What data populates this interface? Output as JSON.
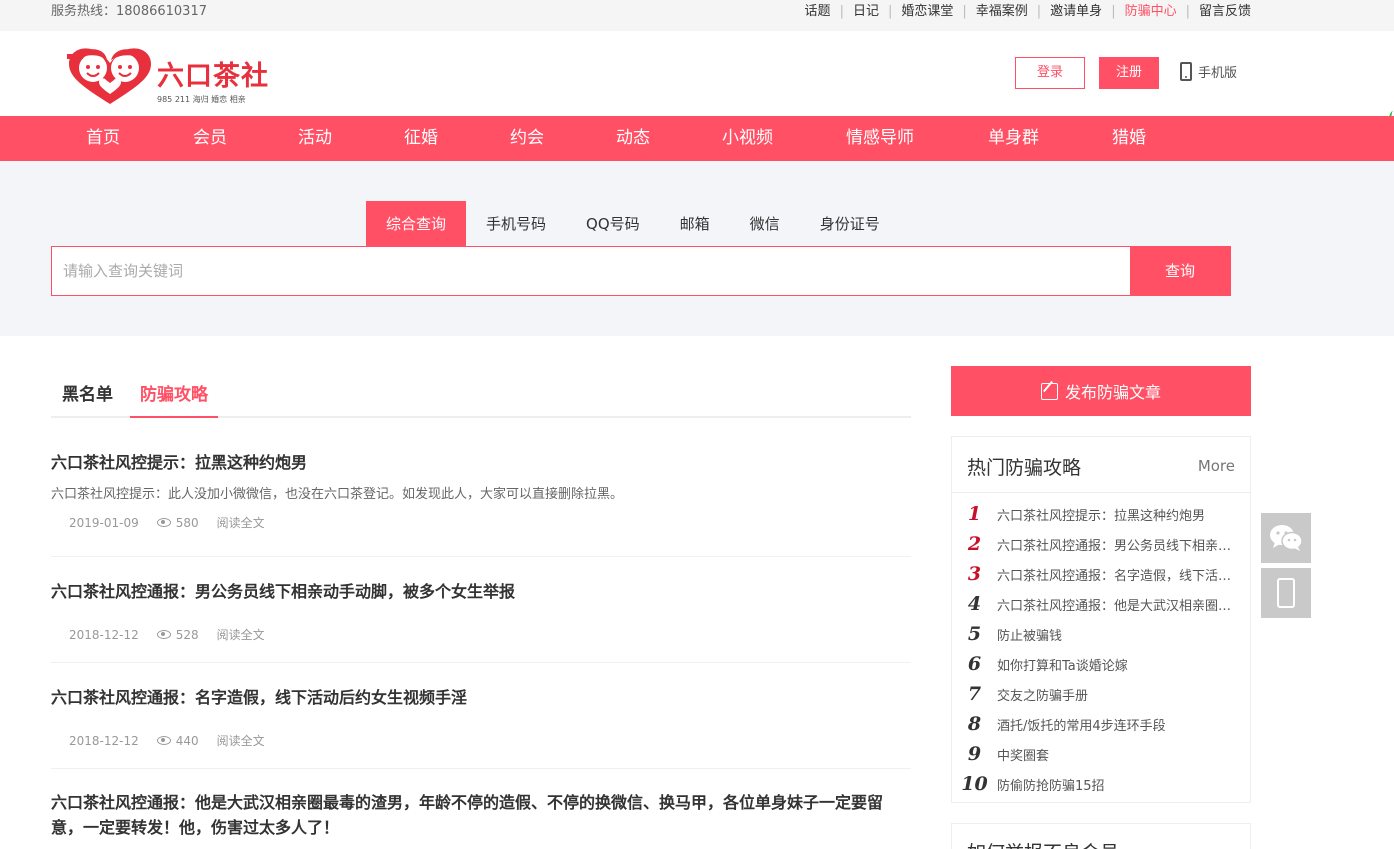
{
  "topbar": {
    "hotline": "服务热线：18086610317",
    "links": [
      "话题",
      "日记",
      "婚恋课堂",
      "幸福案例",
      "邀请单身",
      "防骗中心",
      "留言反馈"
    ],
    "active_link": "防骗中心"
  },
  "header": {
    "logo_name": "六口茶社",
    "logo_slogan": "985 211 海归 婚恋 相亲",
    "login_label": "登录",
    "register_label": "注册",
    "mobile_label": "手机版"
  },
  "nav": {
    "items": [
      "首页",
      "会员",
      "活动",
      "征婚",
      "约会",
      "动态",
      "小视频",
      "情感导师",
      "单身群",
      "猎婚"
    ]
  },
  "search": {
    "tabs": [
      "综合查询",
      "手机号码",
      "QQ号码",
      "邮箱",
      "微信",
      "身份证号"
    ],
    "active_tab": "综合查询",
    "placeholder": "请输入查询关键词",
    "button_label": "查询"
  },
  "main": {
    "tabs": [
      "黑名单",
      "防骗攻略"
    ],
    "active_tab": "防骗攻略",
    "articles": [
      {
        "title": "六口茶社风控提示：拉黑这种约炮男",
        "desc": "六口茶社风控提示：此人没加小微微信，也没在六口茶登记。如发现此人，大家可以直接删除拉黑。",
        "date": "2019-01-09",
        "views": "580",
        "read": "阅读全文"
      },
      {
        "title": "六口茶社风控通报：男公务员线下相亲动手动脚，被多个女生举报",
        "desc": "",
        "date": "2018-12-12",
        "views": "528",
        "read": "阅读全文"
      },
      {
        "title": "六口茶社风控通报：名字造假，线下活动后约女生视频手淫",
        "desc": "",
        "date": "2018-12-12",
        "views": "440",
        "read": "阅读全文"
      },
      {
        "title": "六口茶社风控通报：他是大武汉相亲圈最毒的渣男，年龄不停的造假、不停的换微信、换马甲，各位单身妹子一定要留意，一定要转发！他，伤害过太多人了！",
        "desc": "",
        "date": "",
        "views": "",
        "read": ""
      }
    ]
  },
  "side": {
    "publish_label": "发布防骗文章",
    "hot_title": "热门防骗攻略",
    "hot_more": "More",
    "hot_items": [
      {
        "num": "1",
        "text": "六口茶社风控提示：拉黑这种约炮男"
      },
      {
        "num": "2",
        "text": "六口茶社风控通报：男公务员线下相亲动手动脚"
      },
      {
        "num": "3",
        "text": "六口茶社风控通报：名字造假，线下活动后约女生"
      },
      {
        "num": "4",
        "text": "六口茶社风控通报：他是大武汉相亲圈最毒的渣男"
      },
      {
        "num": "5",
        "text": "防止被骗钱"
      },
      {
        "num": "6",
        "text": "如你打算和Ta谈婚论嫁"
      },
      {
        "num": "7",
        "text": "交友之防骗手册"
      },
      {
        "num": "8",
        "text": "酒托/饭托的常用4步连环手段"
      },
      {
        "num": "9",
        "text": "中奖圈套"
      },
      {
        "num": "10",
        "text": "防偷防抢防骗15招"
      }
    ],
    "report_title": "如何举报不良会员"
  },
  "colors": {
    "accent": "#ff5065",
    "rank_red": "#c7112b"
  }
}
